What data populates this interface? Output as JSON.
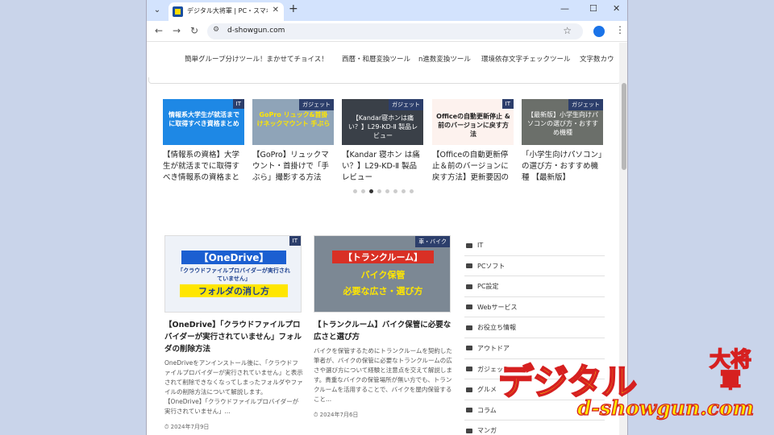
{
  "browser": {
    "tab_title": "デジタル大将軍 | PC・スマホ・ガジェ",
    "url": "d-showgun.com",
    "new_tab": "+",
    "tab_close": "✕",
    "tab_list": "⌄",
    "minimize": "—",
    "maximize": "☐",
    "close": "✕",
    "back": "←",
    "forward": "→",
    "reload": "↻",
    "site_info": "⚙",
    "bookmark": "☆",
    "menu": "⋮"
  },
  "topnav": [
    "簡単グループ分けツール！まかせてチョイス！",
    "西暦・和暦変換ツール",
    "n進数変換ツール",
    "環境依存文字チェックツール",
    "文字数カウ"
  ],
  "carousel": [
    {
      "badge": "IT",
      "thumb_text": "情報系大学生が就活までに取得すべき資格まとめ",
      "title": "【情報系の資格】大学生が就活までに取得すべき情報系の資格まと",
      "thumb_color": "#1e88e5"
    },
    {
      "badge": "ガジェット",
      "thumb_text": "GoPro リュック&首掛けネックマウント 手ぶら",
      "title": "【GoPro】リュックマウント・首掛けで「手ぶら」撮影する方法",
      "thumb_color": "#8fa4b8"
    },
    {
      "badge": "ガジェット",
      "thumb_text": "【Kandar寝ホンは痛い？】L29-KD-Ⅱ 製品レビュー",
      "title": "【Kandar 寝ホン は痛い？】L29-KD-Ⅱ 製品レビュー",
      "thumb_color": "#3a4048"
    },
    {
      "badge": "IT",
      "thumb_text": "Officeの自動更新停止 & 前のバージョンに戻す方法",
      "title": "【Officeの自動更新停止＆前のバージョンに戻す方法】更新要因の",
      "thumb_color": "#fdf2ee"
    },
    {
      "badge": "ガジェット",
      "thumb_text": "【最新版】小学生向けパソコンの選び方・おすすめ機種",
      "title": "「小学生向けパソコン」の選び方・おすすめ機種 【最新版】",
      "thumb_color": "#6b6f6a"
    }
  ],
  "dots_count": 8,
  "dots_active": 2,
  "articles": [
    {
      "badge": "IT",
      "thumb_head": "【OneDrive】",
      "thumb_sub": "「クラウドファイルプロバイダーが実行されていません」",
      "thumb_main": "フォルダの消し方",
      "title": "【OneDrive】「クラウドファイルプロバイダーが実行されていません」フォルダの削除方法",
      "excerpt": "OneDriveをアンインストール後に、「クラウドファイルプロバイダーが実行されていません」と表示されて削除できなくなってしまったフォルダやファイルの削除方法について解説します。 【OneDrive】「クラウドファイルプロバイダーが実行されていません」...",
      "date": "⏱ 2024年7月9日"
    },
    {
      "badge": "車・バイク",
      "thumb_head": "【トランクルーム】",
      "thumb_sub": "バイク保管",
      "thumb_main": "必要な広さ・選び方",
      "title": "【トランクルーム】バイク保管に必要な広さと選び方",
      "excerpt": "バイクを保管するためにトランクルームを契約した筆者が、バイクの保管に必要なトランクルームの広さや選び方について経験と注意点を交えて解説します。貴重なバイクの保管場所が無い方でも、トランクルームを活用することで、バイクを屋内保管すること...",
      "date": "⏱ 2024年7月6日"
    }
  ],
  "sidebar": [
    "IT",
    "PCソフト",
    "PC設定",
    "Webサービス",
    "お役立ち情報",
    "アウトドア",
    "ガジェット",
    "グルメ",
    "コラム",
    "マンガ"
  ],
  "logo": {
    "main": "デジタル",
    "big": "大将軍",
    "url": "d-showgun.com"
  }
}
